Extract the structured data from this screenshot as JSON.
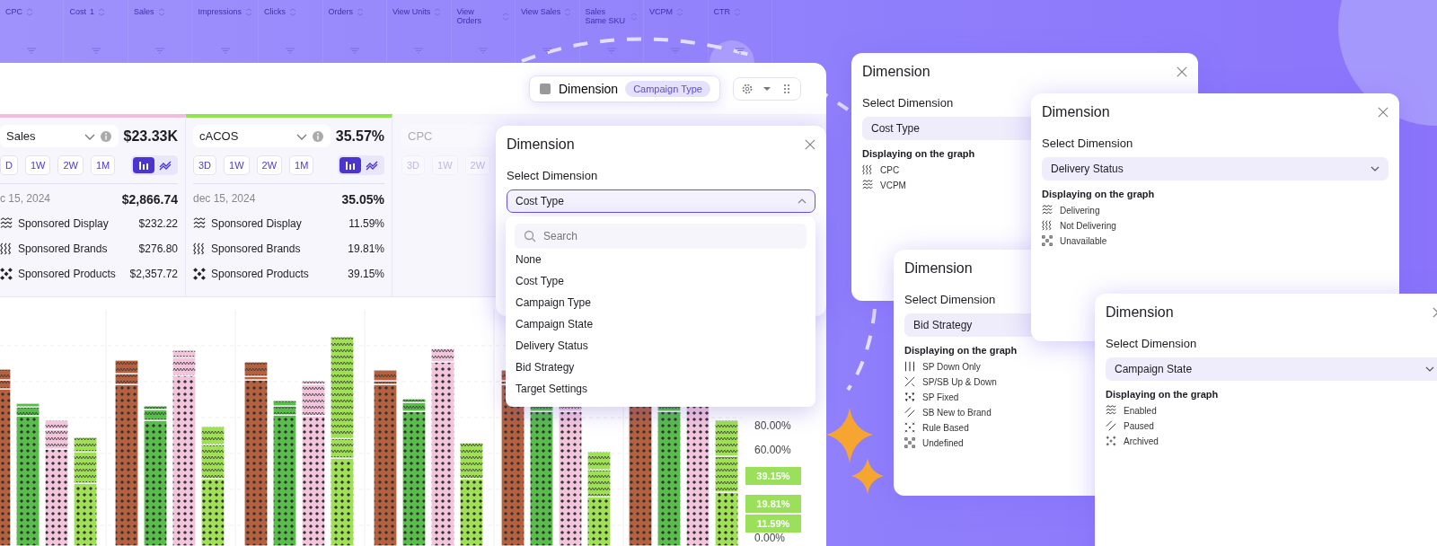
{
  "table_header": {
    "columns": [
      {
        "label": "CPC"
      },
      {
        "label": "Cost",
        "sort": "1"
      },
      {
        "label": "Sales"
      },
      {
        "label": "Impressions"
      },
      {
        "label": "Clicks"
      },
      {
        "label": "Orders"
      },
      {
        "label": "View Units"
      },
      {
        "label": "View Orders"
      },
      {
        "label": "View Sales"
      },
      {
        "label": "Sales Same SKU"
      },
      {
        "label": "VCPM"
      },
      {
        "label": "CTR"
      }
    ]
  },
  "toolbar": {
    "dimension_button": {
      "label": "Dimension",
      "value": "Campaign Type"
    }
  },
  "metric_cards": [
    {
      "metric": "Sales",
      "total": "$23.33K",
      "color": "#f2bcdc",
      "disabled": false,
      "periods": [
        {
          "label": "D",
          "selected": false
        },
        {
          "label": "1W",
          "selected": false
        },
        {
          "label": "2W",
          "selected": false
        },
        {
          "label": "1M",
          "selected": false
        }
      ],
      "views": [
        {
          "kind": "bar",
          "selected": true
        },
        {
          "kind": "line",
          "selected": false
        }
      ],
      "date": "c 15, 2024",
      "date_value": "$2,866.74",
      "rows": [
        {
          "label": "Sponsored Display",
          "value": "$232.22",
          "kind": "zigzag"
        },
        {
          "label": "Sponsored Brands",
          "value": "$276.80",
          "kind": "wavy"
        },
        {
          "label": "Sponsored Products",
          "value": "$2,357.72",
          "kind": "dots"
        }
      ]
    },
    {
      "metric": "cACOS",
      "total": "35.57%",
      "color": "#8ee64a",
      "disabled": false,
      "periods": [
        {
          "label": "3D",
          "selected": false
        },
        {
          "label": "1W",
          "selected": false
        },
        {
          "label": "2W",
          "selected": false
        },
        {
          "label": "1M",
          "selected": false
        }
      ],
      "views": [
        {
          "kind": "bar",
          "selected": true
        },
        {
          "kind": "line",
          "selected": false
        }
      ],
      "date": "dec 15, 2024",
      "date_value": "35.05%",
      "rows": [
        {
          "label": "Sponsored Display",
          "value": "11.59%",
          "kind": "zigzag"
        },
        {
          "label": "Sponsored Brands",
          "value": "19.81%",
          "kind": "wavy"
        },
        {
          "label": "Sponsored Products",
          "value": "39.15%",
          "kind": "dots"
        }
      ]
    },
    {
      "metric": "CPC",
      "disabled": true,
      "periods": [
        {
          "label": "3D",
          "selected": false
        },
        {
          "label": "1W",
          "selected": false
        },
        {
          "label": "2W",
          "selected": false
        }
      ]
    }
  ],
  "chart": {
    "axis_labels": [
      "80.00%",
      "60.00%",
      "0.00%"
    ],
    "value_tags": [
      "39.15%",
      "19.81%",
      "11.59%"
    ]
  },
  "dimension_dialog": {
    "title": "Dimension",
    "label": "Select Dimension",
    "select": {
      "value": "Cost Type",
      "expanded": true
    },
    "search": {
      "placeholder": "Search"
    },
    "options": [
      {
        "label": "None",
        "selected": false
      },
      {
        "label": "Cost Type",
        "selected": false
      },
      {
        "label": "Campaign Type",
        "selected": false
      },
      {
        "label": "Campaign State",
        "selected": false
      },
      {
        "label": "Delivery Status",
        "selected": false
      },
      {
        "label": "Bid Strategy",
        "selected": false
      },
      {
        "label": "Target Settings",
        "selected": false
      }
    ]
  },
  "dialogs": [
    {
      "title": "Dimension",
      "label": "Select Dimension",
      "value": "Cost Type",
      "legend_title": "Displaying on the graph",
      "items": [
        {
          "label": "CPC",
          "kind": "wavy"
        },
        {
          "label": "VCPM",
          "kind": "zigzag"
        }
      ]
    },
    {
      "title": "Dimension",
      "label": "Select Dimension",
      "value": "Delivery Status",
      "legend_title": "Displaying on the graph",
      "items": [
        {
          "label": "Delivering",
          "kind": "zigzag"
        },
        {
          "label": "Not Delivering",
          "kind": "wavy"
        },
        {
          "label": "Unavailable",
          "kind": "squares"
        }
      ]
    },
    {
      "title": "Dimension",
      "label": "Select Dimension",
      "value": "Bid Strategy",
      "legend_title": "Displaying on the graph",
      "items": [
        {
          "label": "SP Down Only",
          "kind": "bars"
        },
        {
          "label": "SP/SB Up & Down",
          "kind": "cross"
        },
        {
          "label": "SP Fixed",
          "kind": "triangles"
        },
        {
          "label": "SB New to Brand",
          "kind": "diagonal"
        },
        {
          "label": "Rule Based",
          "kind": "xmarks"
        },
        {
          "label": "Undefined",
          "kind": "squares"
        }
      ]
    },
    {
      "title": "Dimension",
      "label": "Select Dimension",
      "value": "Campaign State",
      "legend_title": "Displaying on the graph",
      "items": [
        {
          "label": "Enabled",
          "kind": "zigzag"
        },
        {
          "label": "Paused",
          "kind": "diagonal"
        },
        {
          "label": "Archived",
          "kind": "plus"
        }
      ]
    }
  ]
}
